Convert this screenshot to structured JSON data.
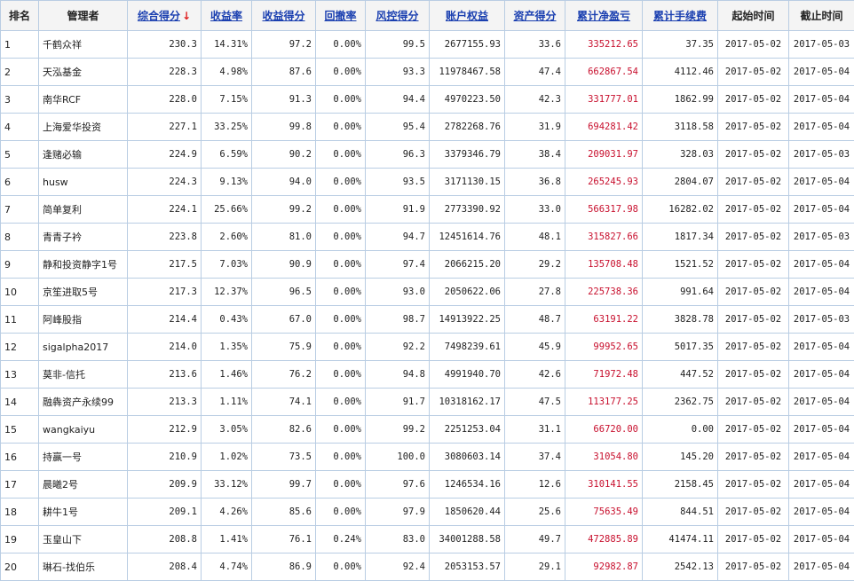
{
  "columns": {
    "rank": "排名",
    "manager": "管理者",
    "score": "综合得分",
    "return_rate": "收益率",
    "return_score": "收益得分",
    "drawdown": "回撤率",
    "risk_score": "风控得分",
    "equity": "账户权益",
    "asset_score": "资产得分",
    "net_pnl": "累计净盈亏",
    "fees": "累计手续费",
    "start": "起始时间",
    "end": "截止时间"
  },
  "sort_arrow": "↓",
  "colors": {
    "header_link": "#1a3fb0",
    "profit_red": "#c8102e",
    "border": "#b9cde3"
  },
  "rows": [
    {
      "rank": "1",
      "manager": "千鹤众祥",
      "score": "230.3",
      "return_rate": "14.31%",
      "return_score": "97.2",
      "drawdown": "0.00%",
      "risk_score": "99.5",
      "equity": "2677155.93",
      "asset_score": "33.6",
      "net_pnl": "335212.65",
      "fees": "37.35",
      "start": "2017-05-02",
      "end": "2017-05-03"
    },
    {
      "rank": "2",
      "manager": "天泓基金",
      "score": "228.3",
      "return_rate": "4.98%",
      "return_score": "87.6",
      "drawdown": "0.00%",
      "risk_score": "93.3",
      "equity": "11978467.58",
      "asset_score": "47.4",
      "net_pnl": "662867.54",
      "fees": "4112.46",
      "start": "2017-05-02",
      "end": "2017-05-04"
    },
    {
      "rank": "3",
      "manager": "南华RCF",
      "score": "228.0",
      "return_rate": "7.15%",
      "return_score": "91.3",
      "drawdown": "0.00%",
      "risk_score": "94.4",
      "equity": "4970223.50",
      "asset_score": "42.3",
      "net_pnl": "331777.01",
      "fees": "1862.99",
      "start": "2017-05-02",
      "end": "2017-05-04"
    },
    {
      "rank": "4",
      "manager": "上海爱华投资",
      "score": "227.1",
      "return_rate": "33.25%",
      "return_score": "99.8",
      "drawdown": "0.00%",
      "risk_score": "95.4",
      "equity": "2782268.76",
      "asset_score": "31.9",
      "net_pnl": "694281.42",
      "fees": "3118.58",
      "start": "2017-05-02",
      "end": "2017-05-04"
    },
    {
      "rank": "5",
      "manager": "逢赌必输",
      "score": "224.9",
      "return_rate": "6.59%",
      "return_score": "90.2",
      "drawdown": "0.00%",
      "risk_score": "96.3",
      "equity": "3379346.79",
      "asset_score": "38.4",
      "net_pnl": "209031.97",
      "fees": "328.03",
      "start": "2017-05-02",
      "end": "2017-05-03"
    },
    {
      "rank": "6",
      "manager": "husw",
      "score": "224.3",
      "return_rate": "9.13%",
      "return_score": "94.0",
      "drawdown": "0.00%",
      "risk_score": "93.5",
      "equity": "3171130.15",
      "asset_score": "36.8",
      "net_pnl": "265245.93",
      "fees": "2804.07",
      "start": "2017-05-02",
      "end": "2017-05-04"
    },
    {
      "rank": "7",
      "manager": "简单复利",
      "score": "224.1",
      "return_rate": "25.66%",
      "return_score": "99.2",
      "drawdown": "0.00%",
      "risk_score": "91.9",
      "equity": "2773390.92",
      "asset_score": "33.0",
      "net_pnl": "566317.98",
      "fees": "16282.02",
      "start": "2017-05-02",
      "end": "2017-05-04"
    },
    {
      "rank": "8",
      "manager": "青青子衿",
      "score": "223.8",
      "return_rate": "2.60%",
      "return_score": "81.0",
      "drawdown": "0.00%",
      "risk_score": "94.7",
      "equity": "12451614.76",
      "asset_score": "48.1",
      "net_pnl": "315827.66",
      "fees": "1817.34",
      "start": "2017-05-02",
      "end": "2017-05-03"
    },
    {
      "rank": "9",
      "manager": "静和投资静字1号",
      "score": "217.5",
      "return_rate": "7.03%",
      "return_score": "90.9",
      "drawdown": "0.00%",
      "risk_score": "97.4",
      "equity": "2066215.20",
      "asset_score": "29.2",
      "net_pnl": "135708.48",
      "fees": "1521.52",
      "start": "2017-05-02",
      "end": "2017-05-04"
    },
    {
      "rank": "10",
      "manager": "京笙进取5号",
      "score": "217.3",
      "return_rate": "12.37%",
      "return_score": "96.5",
      "drawdown": "0.00%",
      "risk_score": "93.0",
      "equity": "2050622.06",
      "asset_score": "27.8",
      "net_pnl": "225738.36",
      "fees": "991.64",
      "start": "2017-05-02",
      "end": "2017-05-04"
    },
    {
      "rank": "11",
      "manager": "阿峰股指",
      "score": "214.4",
      "return_rate": "0.43%",
      "return_score": "67.0",
      "drawdown": "0.00%",
      "risk_score": "98.7",
      "equity": "14913922.25",
      "asset_score": "48.7",
      "net_pnl": "63191.22",
      "fees": "3828.78",
      "start": "2017-05-02",
      "end": "2017-05-03"
    },
    {
      "rank": "12",
      "manager": "sigalpha2017",
      "score": "214.0",
      "return_rate": "1.35%",
      "return_score": "75.9",
      "drawdown": "0.00%",
      "risk_score": "92.2",
      "equity": "7498239.61",
      "asset_score": "45.9",
      "net_pnl": "99952.65",
      "fees": "5017.35",
      "start": "2017-05-02",
      "end": "2017-05-04"
    },
    {
      "rank": "13",
      "manager": "莫非-信托",
      "score": "213.6",
      "return_rate": "1.46%",
      "return_score": "76.2",
      "drawdown": "0.00%",
      "risk_score": "94.8",
      "equity": "4991940.70",
      "asset_score": "42.6",
      "net_pnl": "71972.48",
      "fees": "447.52",
      "start": "2017-05-02",
      "end": "2017-05-04"
    },
    {
      "rank": "14",
      "manager": "融犇资产永续99",
      "score": "213.3",
      "return_rate": "1.11%",
      "return_score": "74.1",
      "drawdown": "0.00%",
      "risk_score": "91.7",
      "equity": "10318162.17",
      "asset_score": "47.5",
      "net_pnl": "113177.25",
      "fees": "2362.75",
      "start": "2017-05-02",
      "end": "2017-05-04"
    },
    {
      "rank": "15",
      "manager": "wangkaiyu",
      "score": "212.9",
      "return_rate": "3.05%",
      "return_score": "82.6",
      "drawdown": "0.00%",
      "risk_score": "99.2",
      "equity": "2251253.04",
      "asset_score": "31.1",
      "net_pnl": "66720.00",
      "fees": "0.00",
      "start": "2017-05-02",
      "end": "2017-05-04"
    },
    {
      "rank": "16",
      "manager": "持赢一号",
      "score": "210.9",
      "return_rate": "1.02%",
      "return_score": "73.5",
      "drawdown": "0.00%",
      "risk_score": "100.0",
      "equity": "3080603.14",
      "asset_score": "37.4",
      "net_pnl": "31054.80",
      "fees": "145.20",
      "start": "2017-05-02",
      "end": "2017-05-04"
    },
    {
      "rank": "17",
      "manager": "晨曦2号",
      "score": "209.9",
      "return_rate": "33.12%",
      "return_score": "99.7",
      "drawdown": "0.00%",
      "risk_score": "97.6",
      "equity": "1246534.16",
      "asset_score": "12.6",
      "net_pnl": "310141.55",
      "fees": "2158.45",
      "start": "2017-05-02",
      "end": "2017-05-04"
    },
    {
      "rank": "18",
      "manager": "耕牛1号",
      "score": "209.1",
      "return_rate": "4.26%",
      "return_score": "85.6",
      "drawdown": "0.00%",
      "risk_score": "97.9",
      "equity": "1850620.44",
      "asset_score": "25.6",
      "net_pnl": "75635.49",
      "fees": "844.51",
      "start": "2017-05-02",
      "end": "2017-05-04"
    },
    {
      "rank": "19",
      "manager": "玉皇山下",
      "score": "208.8",
      "return_rate": "1.41%",
      "return_score": "76.1",
      "drawdown": "0.24%",
      "risk_score": "83.0",
      "equity": "34001288.58",
      "asset_score": "49.7",
      "net_pnl": "472885.89",
      "fees": "41474.11",
      "start": "2017-05-02",
      "end": "2017-05-04"
    },
    {
      "rank": "20",
      "manager": "琳石-找伯乐",
      "score": "208.4",
      "return_rate": "4.74%",
      "return_score": "86.9",
      "drawdown": "0.00%",
      "risk_score": "92.4",
      "equity": "2053153.57",
      "asset_score": "29.1",
      "net_pnl": "92982.87",
      "fees": "2542.13",
      "start": "2017-05-02",
      "end": "2017-05-04"
    }
  ]
}
